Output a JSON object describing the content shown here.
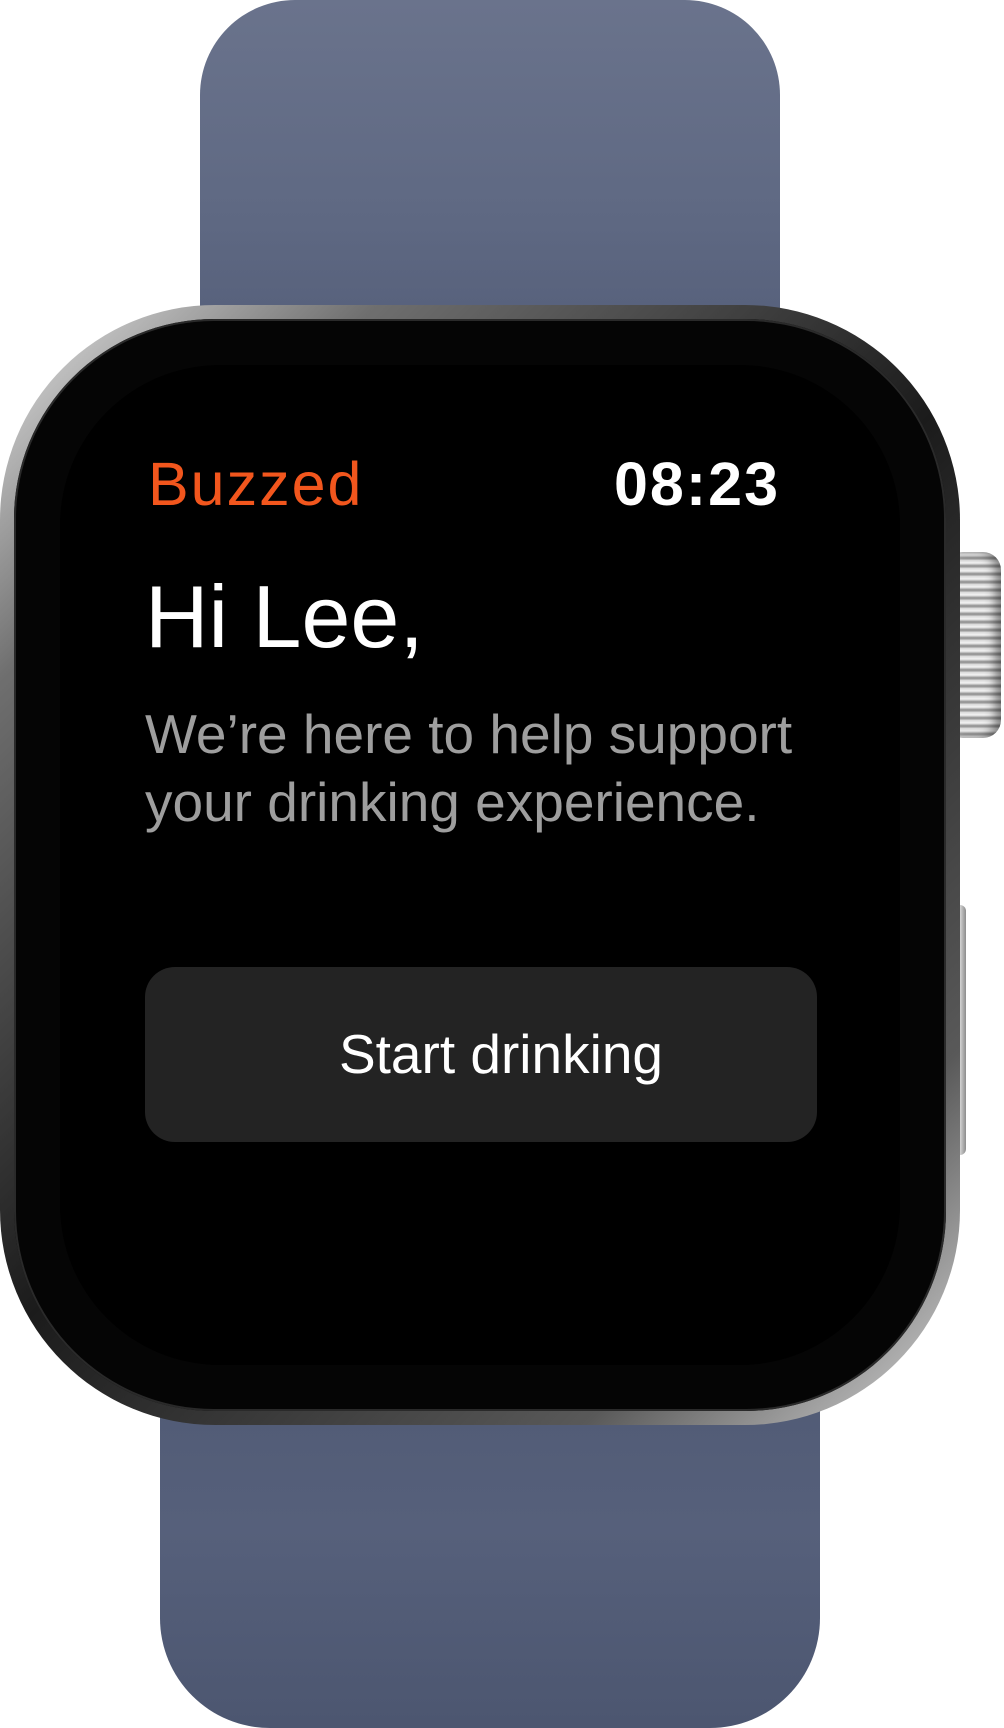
{
  "app": {
    "name": "Buzzed",
    "time": "08:23"
  },
  "welcome": {
    "greeting": "Hi Lee,",
    "message": "We’re here to help support your drinking experience."
  },
  "actions": {
    "start_label": "Start drinking"
  },
  "colors": {
    "accent": "#f2561d",
    "screen_background": "#000000",
    "button_background": "#232323",
    "secondary_text": "#9e9e9e",
    "band": "#5c6681"
  }
}
